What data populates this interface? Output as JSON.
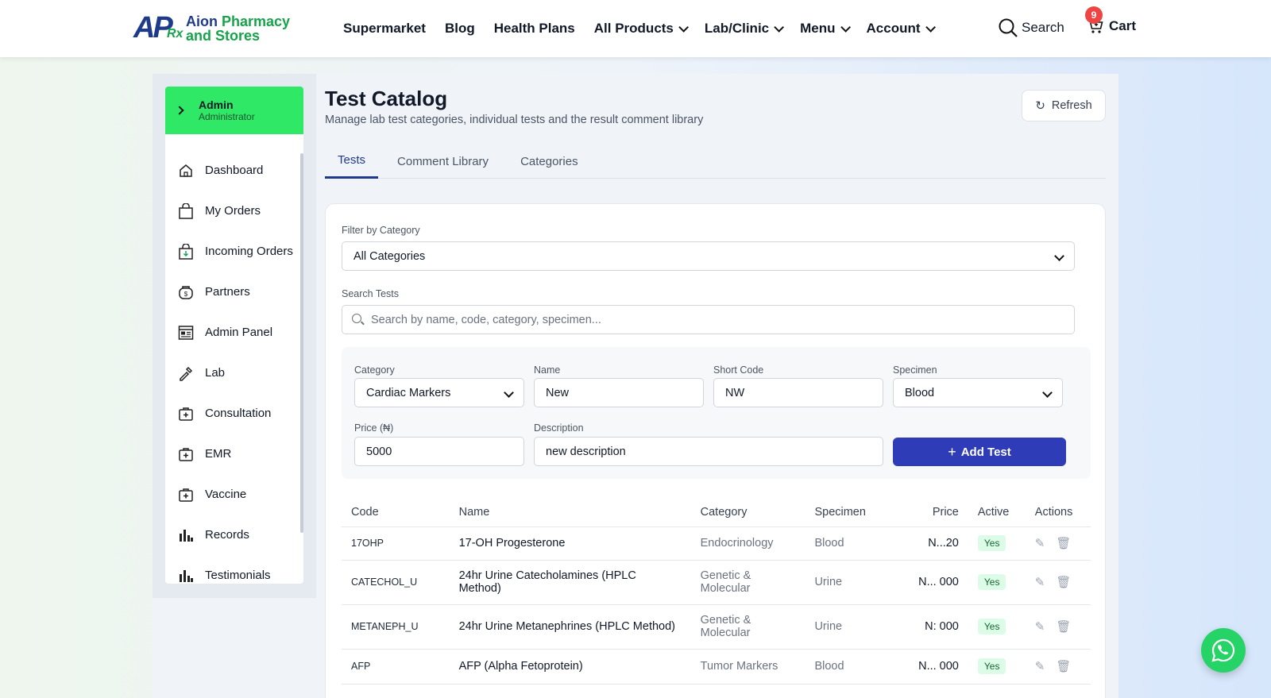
{
  "brand": {
    "line1a": "Aion",
    "line1b": " Pharmacy",
    "line2": "and Stores"
  },
  "nav": {
    "links": [
      "Supermarket",
      "Blog",
      "Health Plans",
      "All Products",
      "Lab/Clinic",
      "Menu",
      "Account"
    ],
    "search": "Search",
    "cart": "Cart",
    "cart_count": "9"
  },
  "sidebar": {
    "user_name": "Admin",
    "user_role": "Administrator",
    "items": [
      {
        "label": "Dashboard",
        "icon": "home-icon"
      },
      {
        "label": "My Orders",
        "icon": "shopping-bag-icon"
      },
      {
        "label": "Incoming Orders",
        "icon": "incoming-bag-icon"
      },
      {
        "label": "Partners",
        "icon": "partners-icon"
      },
      {
        "label": "Admin Panel",
        "icon": "admin-panel-icon"
      },
      {
        "label": "Lab",
        "icon": "lab-pipette-icon"
      },
      {
        "label": "Consultation",
        "icon": "medical-kit-icon"
      },
      {
        "label": "EMR",
        "icon": "medical-kit-icon"
      },
      {
        "label": "Vaccine",
        "icon": "medical-kit-icon"
      },
      {
        "label": "Records",
        "icon": "bar-chart-icon"
      },
      {
        "label": "Testimonials",
        "icon": "bar-chart-icon"
      }
    ]
  },
  "page": {
    "title": "Test Catalog",
    "subtitle": "Manage lab test categories, individual tests and the result comment library",
    "refresh": "Refresh",
    "tabs": [
      "Tests",
      "Comment Library",
      "Categories"
    ],
    "active_tab": "Tests"
  },
  "filter": {
    "label": "Filter by Category",
    "value": "All Categories",
    "search_label": "Search Tests",
    "search_placeholder": "Search by name, code, category, specimen..."
  },
  "form": {
    "category_label": "Category",
    "category_value": "Cardiac Markers",
    "name_label": "Name",
    "name_value": "New",
    "code_label": "Short Code",
    "code_value": "NW",
    "specimen_label": "Specimen",
    "specimen_value": "Blood",
    "price_label": "Price (₦)",
    "price_value": "5000",
    "desc_label": "Description",
    "desc_value": "new description",
    "add_button": "Add Test"
  },
  "table": {
    "headers": [
      "Code",
      "Name",
      "Category",
      "Specimen",
      "Price",
      "Active",
      "Actions"
    ],
    "rows": [
      {
        "code": "17OHP",
        "name": "17-OH Progesterone",
        "category": "Endocrinology",
        "specimen": "Blood",
        "price": "N...20",
        "active": "Yes"
      },
      {
        "code": "CATECHOL_U",
        "name": "24hr Urine Catecholamines (HPLC Method)",
        "category": "Genetic & Molecular",
        "specimen": "Urine",
        "price": "N... 000",
        "active": "Yes"
      },
      {
        "code": "METANEPH_U",
        "name": "24hr Urine Metanephrines (HPLC Method)",
        "category": "Genetic & Molecular",
        "specimen": "Urine",
        "price": "N: 000",
        "active": "Yes"
      },
      {
        "code": "AFP",
        "name": "AFP (Alpha Fetoprotein)",
        "category": "Tumor Markers",
        "specimen": "Blood",
        "price": "N... 000",
        "active": "Yes"
      }
    ]
  },
  "colors": {
    "accent": "#2e3cb8",
    "admin_card": "#2fe866",
    "whatsapp": "#25d366"
  }
}
